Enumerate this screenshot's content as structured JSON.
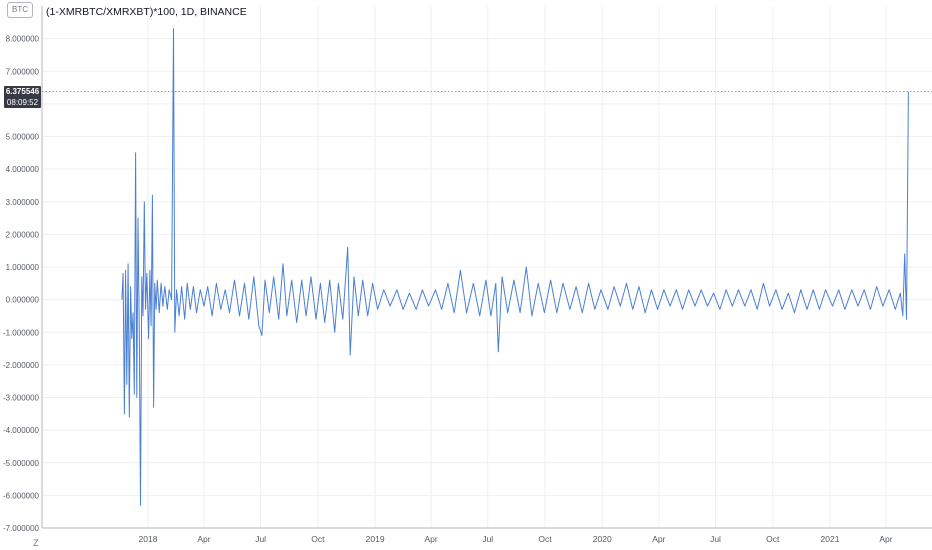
{
  "header": {
    "badge": "BTC",
    "title": "(1-XMRBTC/XMRXBT)*100, 1D, BINANCE"
  },
  "last_price": {
    "value": "6.375546",
    "time": "08:09:52"
  },
  "footer": {
    "z_label": "Z"
  },
  "colors": {
    "line": "#4a7fd4",
    "grid": "#eef0f3",
    "axis_text": "#555a66",
    "lastline": "#7a7f8c"
  },
  "chart_data": {
    "type": "line",
    "title": "(1-XMRBTC/XMRXBT)*100, 1D, BINANCE",
    "xlabel": "",
    "ylabel": "",
    "ylim": [
      -7.0,
      9.0
    ],
    "y_ticks": [
      "8.000000",
      "7.000000",
      "6.000000",
      "5.000000",
      "4.000000",
      "3.000000",
      "2.000000",
      "1.000000",
      "0.000000",
      "-1.000000",
      "-2.000000",
      "-3.000000",
      "-4.000000",
      "-5.000000",
      "-6.000000",
      "-7.000000"
    ],
    "x_tick_labels": [
      "2018",
      "Apr",
      "Jul",
      "Oct",
      "2019",
      "Apr",
      "Jul",
      "Oct",
      "2020",
      "Apr",
      "Jul",
      "Oct",
      "2021",
      "Apr"
    ],
    "last_value": 6.375546,
    "grid": true,
    "series": [
      {
        "points": [
          [
            "2017-11-20",
            0.0
          ],
          [
            "2017-11-22",
            0.8
          ],
          [
            "2017-11-24",
            -3.5
          ],
          [
            "2017-11-26",
            0.9
          ],
          [
            "2017-11-28",
            -2.6
          ],
          [
            "2017-11-30",
            1.1
          ],
          [
            "2017-12-02",
            -3.6
          ],
          [
            "2017-12-04",
            0.4
          ],
          [
            "2017-12-06",
            -1.2
          ],
          [
            "2017-12-08",
            -0.4
          ],
          [
            "2017-12-10",
            -2.9
          ],
          [
            "2017-12-12",
            4.5
          ],
          [
            "2017-12-14",
            -3.0
          ],
          [
            "2017-12-16",
            2.5
          ],
          [
            "2017-12-18",
            -1.0
          ],
          [
            "2017-12-20",
            -6.3
          ],
          [
            "2017-12-22",
            0.7
          ],
          [
            "2017-12-24",
            -0.5
          ],
          [
            "2017-12-26",
            3.0
          ],
          [
            "2017-12-28",
            -0.3
          ],
          [
            "2017-12-30",
            0.8
          ],
          [
            "2018-01-02",
            -1.2
          ],
          [
            "2018-01-04",
            0.9
          ],
          [
            "2018-01-06",
            -0.8
          ],
          [
            "2018-01-08",
            3.2
          ],
          [
            "2018-01-10",
            -3.3
          ],
          [
            "2018-01-12",
            0.5
          ],
          [
            "2018-01-14",
            -0.3
          ],
          [
            "2018-01-16",
            0.6
          ],
          [
            "2018-01-19",
            -0.4
          ],
          [
            "2018-01-22",
            0.5
          ],
          [
            "2018-01-25",
            -0.2
          ],
          [
            "2018-01-28",
            0.4
          ],
          [
            "2018-02-01",
            -0.3
          ],
          [
            "2018-02-04",
            0.3
          ],
          [
            "2018-02-08",
            0.0
          ],
          [
            "2018-02-11",
            8.3
          ],
          [
            "2018-02-13",
            -1.0
          ],
          [
            "2018-02-16",
            0.3
          ],
          [
            "2018-02-20",
            -0.5
          ],
          [
            "2018-02-24",
            0.4
          ],
          [
            "2018-03-01",
            -0.6
          ],
          [
            "2018-03-05",
            0.5
          ],
          [
            "2018-03-10",
            -0.3
          ],
          [
            "2018-03-15",
            0.4
          ],
          [
            "2018-03-20",
            -0.4
          ],
          [
            "2018-03-26",
            0.3
          ],
          [
            "2018-04-01",
            -0.2
          ],
          [
            "2018-04-07",
            0.4
          ],
          [
            "2018-04-14",
            -0.5
          ],
          [
            "2018-04-21",
            0.5
          ],
          [
            "2018-04-28",
            -0.3
          ],
          [
            "2018-05-05",
            0.3
          ],
          [
            "2018-05-12",
            -0.4
          ],
          [
            "2018-05-20",
            0.6
          ],
          [
            "2018-05-28",
            -0.5
          ],
          [
            "2018-06-05",
            0.5
          ],
          [
            "2018-06-12",
            -0.6
          ],
          [
            "2018-06-20",
            0.7
          ],
          [
            "2018-06-28",
            -0.8
          ],
          [
            "2018-07-03",
            -1.1
          ],
          [
            "2018-07-08",
            0.6
          ],
          [
            "2018-07-15",
            -0.4
          ],
          [
            "2018-07-22",
            0.7
          ],
          [
            "2018-07-30",
            -0.6
          ],
          [
            "2018-08-06",
            1.1
          ],
          [
            "2018-08-12",
            -0.5
          ],
          [
            "2018-08-20",
            0.6
          ],
          [
            "2018-08-28",
            -0.7
          ],
          [
            "2018-09-05",
            0.6
          ],
          [
            "2018-09-12",
            -0.5
          ],
          [
            "2018-09-20",
            0.7
          ],
          [
            "2018-09-28",
            -0.6
          ],
          [
            "2018-10-05",
            0.5
          ],
          [
            "2018-10-12",
            -0.7
          ],
          [
            "2018-10-20",
            0.6
          ],
          [
            "2018-10-28",
            -1.0
          ],
          [
            "2018-11-03",
            0.5
          ],
          [
            "2018-11-10",
            -0.6
          ],
          [
            "2018-11-18",
            1.6
          ],
          [
            "2018-11-22",
            -1.7
          ],
          [
            "2018-11-28",
            0.7
          ],
          [
            "2018-12-05",
            -0.5
          ],
          [
            "2018-12-12",
            0.6
          ],
          [
            "2018-12-20",
            -0.5
          ],
          [
            "2018-12-28",
            0.5
          ],
          [
            "2019-01-05",
            -0.3
          ],
          [
            "2019-01-15",
            0.3
          ],
          [
            "2019-01-25",
            -0.2
          ],
          [
            "2019-02-05",
            0.3
          ],
          [
            "2019-02-15",
            -0.3
          ],
          [
            "2019-02-25",
            0.2
          ],
          [
            "2019-03-08",
            -0.3
          ],
          [
            "2019-03-18",
            0.3
          ],
          [
            "2019-03-28",
            -0.2
          ],
          [
            "2019-04-08",
            0.3
          ],
          [
            "2019-04-18",
            -0.3
          ],
          [
            "2019-04-28",
            0.5
          ],
          [
            "2019-05-08",
            -0.4
          ],
          [
            "2019-05-18",
            0.9
          ],
          [
            "2019-05-28",
            -0.4
          ],
          [
            "2019-06-08",
            0.5
          ],
          [
            "2019-06-18",
            -0.5
          ],
          [
            "2019-06-28",
            0.6
          ],
          [
            "2019-07-06",
            -0.5
          ],
          [
            "2019-07-14",
            0.5
          ],
          [
            "2019-07-18",
            -1.6
          ],
          [
            "2019-07-24",
            0.7
          ],
          [
            "2019-08-02",
            -0.4
          ],
          [
            "2019-08-12",
            0.6
          ],
          [
            "2019-08-22",
            -0.4
          ],
          [
            "2019-09-01",
            1.0
          ],
          [
            "2019-09-10",
            -0.5
          ],
          [
            "2019-09-20",
            0.5
          ],
          [
            "2019-09-30",
            -0.4
          ],
          [
            "2019-10-10",
            0.6
          ],
          [
            "2019-10-20",
            -0.4
          ],
          [
            "2019-10-30",
            0.5
          ],
          [
            "2019-11-10",
            -0.3
          ],
          [
            "2019-11-20",
            0.4
          ],
          [
            "2019-11-30",
            -0.4
          ],
          [
            "2019-12-10",
            0.5
          ],
          [
            "2019-12-20",
            -0.3
          ],
          [
            "2019-12-30",
            0.3
          ],
          [
            "2020-01-10",
            -0.3
          ],
          [
            "2020-01-20",
            0.4
          ],
          [
            "2020-01-30",
            -0.2
          ],
          [
            "2020-02-09",
            0.5
          ],
          [
            "2020-02-19",
            -0.3
          ],
          [
            "2020-02-29",
            0.4
          ],
          [
            "2020-03-10",
            -0.4
          ],
          [
            "2020-03-20",
            0.3
          ],
          [
            "2020-03-30",
            -0.3
          ],
          [
            "2020-04-09",
            0.3
          ],
          [
            "2020-04-19",
            -0.2
          ],
          [
            "2020-04-29",
            0.3
          ],
          [
            "2020-05-09",
            -0.3
          ],
          [
            "2020-05-19",
            0.3
          ],
          [
            "2020-05-29",
            -0.2
          ],
          [
            "2020-06-08",
            0.3
          ],
          [
            "2020-06-18",
            -0.2
          ],
          [
            "2020-06-28",
            0.2
          ],
          [
            "2020-07-08",
            -0.3
          ],
          [
            "2020-07-18",
            0.3
          ],
          [
            "2020-07-28",
            -0.2
          ],
          [
            "2020-08-07",
            0.3
          ],
          [
            "2020-08-17",
            -0.2
          ],
          [
            "2020-08-27",
            0.3
          ],
          [
            "2020-09-06",
            -0.3
          ],
          [
            "2020-09-16",
            0.5
          ],
          [
            "2020-09-26",
            -0.2
          ],
          [
            "2020-10-06",
            0.3
          ],
          [
            "2020-10-16",
            -0.3
          ],
          [
            "2020-10-26",
            0.2
          ],
          [
            "2020-11-05",
            -0.4
          ],
          [
            "2020-11-15",
            0.3
          ],
          [
            "2020-11-25",
            -0.3
          ],
          [
            "2020-12-05",
            0.3
          ],
          [
            "2020-12-15",
            -0.3
          ],
          [
            "2020-12-25",
            0.3
          ],
          [
            "2021-01-05",
            -0.2
          ],
          [
            "2021-01-15",
            0.3
          ],
          [
            "2021-01-25",
            -0.3
          ],
          [
            "2021-02-05",
            0.3
          ],
          [
            "2021-02-15",
            -0.2
          ],
          [
            "2021-02-25",
            0.3
          ],
          [
            "2021-03-07",
            -0.3
          ],
          [
            "2021-03-17",
            0.4
          ],
          [
            "2021-03-27",
            -0.2
          ],
          [
            "2021-04-06",
            0.3
          ],
          [
            "2021-04-16",
            -0.3
          ],
          [
            "2021-04-24",
            0.2
          ],
          [
            "2021-04-28",
            -0.5
          ],
          [
            "2021-05-01",
            1.4
          ],
          [
            "2021-05-04",
            -0.6
          ],
          [
            "2021-05-07",
            6.375546
          ]
        ]
      }
    ]
  }
}
